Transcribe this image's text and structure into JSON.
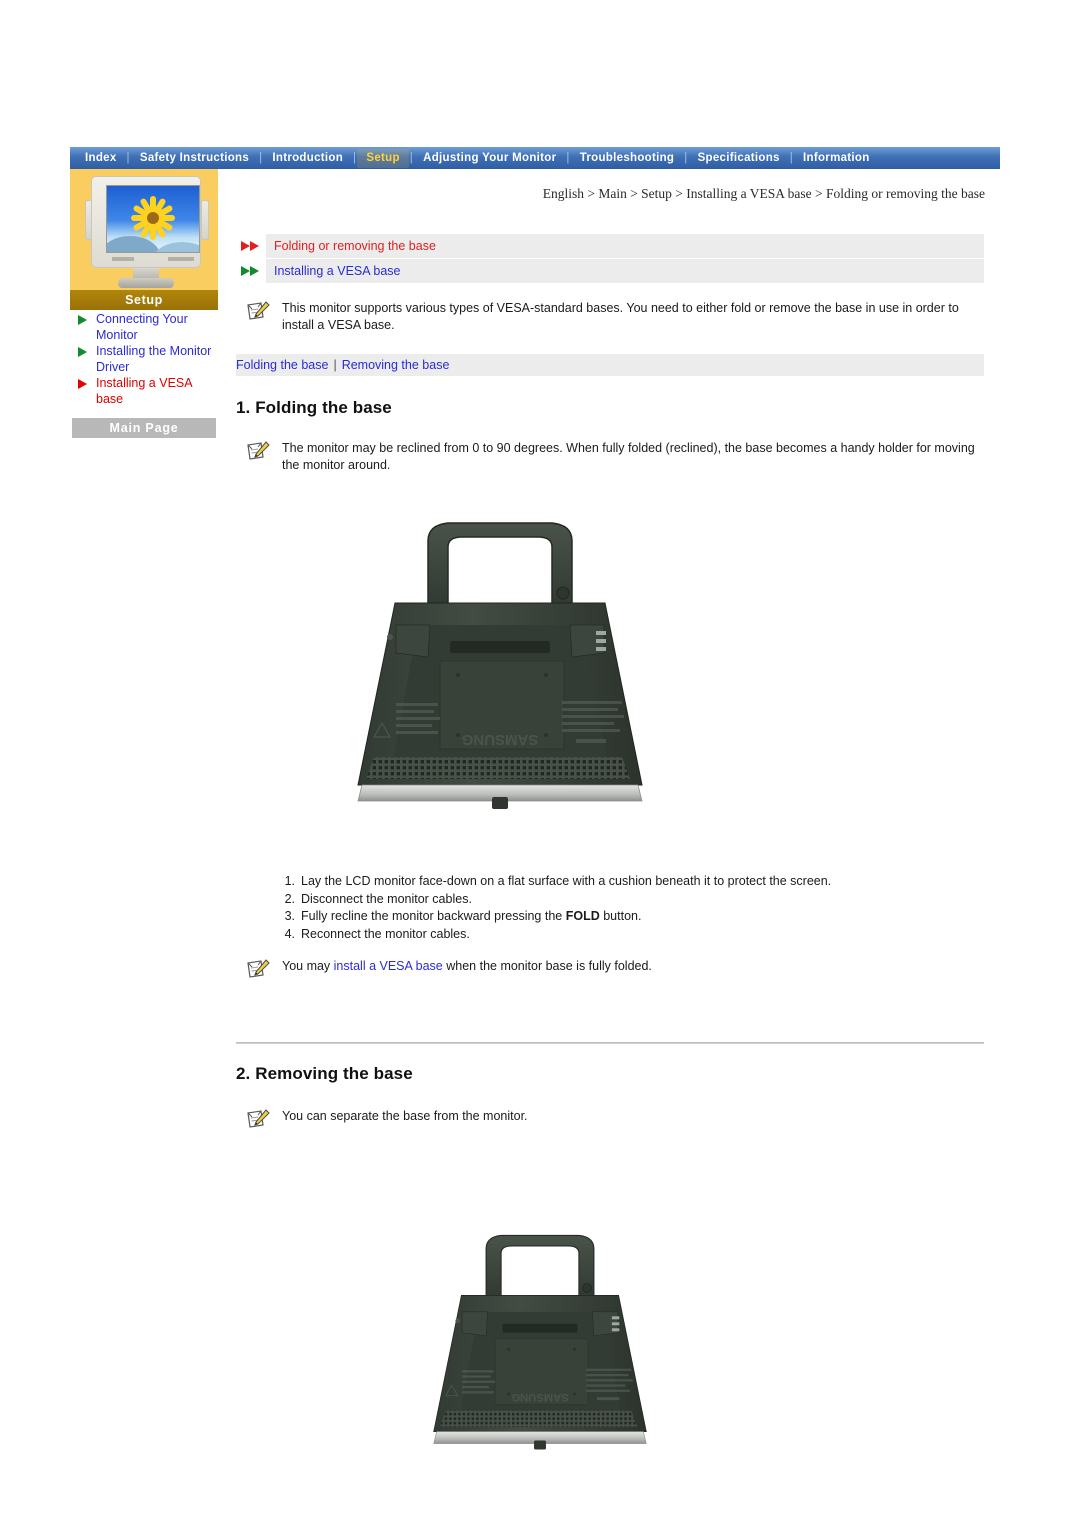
{
  "topnav": {
    "items": [
      {
        "label": "Index",
        "active": false
      },
      {
        "label": "Safety Instructions",
        "active": false
      },
      {
        "label": "Introduction",
        "active": false
      },
      {
        "label": "Setup",
        "active": true
      },
      {
        "label": "Adjusting Your Monitor",
        "active": false
      },
      {
        "label": "Troubleshooting",
        "active": false
      },
      {
        "label": "Specifications",
        "active": false
      },
      {
        "label": "Information",
        "active": false
      }
    ],
    "separator": "|",
    "bg_color": "#3f6fb5",
    "active_color": "#ffd23a"
  },
  "sidebar": {
    "thumbnail_name": "crt-monitor-sunflower-thumbnail",
    "section_title": "Setup",
    "section_bar_color": "#9a7208",
    "items": [
      {
        "label": "Connecting Your Monitor",
        "current": false
      },
      {
        "label": "Installing the Monitor Driver",
        "current": false
      },
      {
        "label": "Installing a VESA base",
        "current": true
      }
    ],
    "main_page_button": "Main Page",
    "panel_color": "#facd61"
  },
  "breadcrumb": "English > Main > Setup > Installing a VESA base > Folding or removing the base",
  "main": {
    "link_rows": [
      {
        "label": "Folding or removing the base",
        "color": "red",
        "icon": "double-arrow-right-icon"
      },
      {
        "label": "Installing a VESA base",
        "color": "blue",
        "icon": "double-arrow-right-icon"
      }
    ],
    "intro_notice": "This monitor supports various types of VESA-standard bases. You need to either fold or remove the base in use in order to install a VESA base.",
    "subnav": {
      "left_link": "Folding the base",
      "separator": "|",
      "right_link": "Removing the base"
    },
    "section1": {
      "heading": "1. Folding the base",
      "notice": "The monitor may be reclined from 0 to 90 degrees. When fully folded (reclined), the base becomes a handy holder for moving the monitor around.",
      "image_name": "folded-monitor-base-with-handle-photo",
      "steps": [
        {
          "num": "1.",
          "text_before": "Lay the LCD monitor face-down on a flat surface with a cushion beneath it to protect the screen.",
          "bold": "",
          "text_after": ""
        },
        {
          "num": "2.",
          "text_before": "Disconnect the monitor cables.",
          "bold": "",
          "text_after": ""
        },
        {
          "num": "3.",
          "text_before": "Fully recline the monitor backward pressing the ",
          "bold": "FOLD",
          "text_after": " button."
        },
        {
          "num": "4.",
          "text_before": "Reconnect the monitor cables.",
          "bold": "",
          "text_after": ""
        }
      ],
      "footer_notice_before": "You may ",
      "footer_notice_link": "install a VESA base",
      "footer_notice_after": " when the monitor base is fully folded."
    },
    "section2": {
      "heading": "2. Removing the base",
      "notice": "You can separate the base from the monitor.",
      "image_name": "separated-monitor-base-photo"
    }
  },
  "icons": {
    "notice": "note-pencil-icon",
    "bullet_green": "green-triangle-bullet-icon",
    "bullet_red": "red-triangle-bullet-icon"
  },
  "colors": {
    "link_blue": "#2b2bd6",
    "link_red": "#e21f1f",
    "row_bg": "#ececec",
    "nav_blue": "#3f6fb5",
    "orange": "#facd61",
    "brown": "#9a7208"
  }
}
